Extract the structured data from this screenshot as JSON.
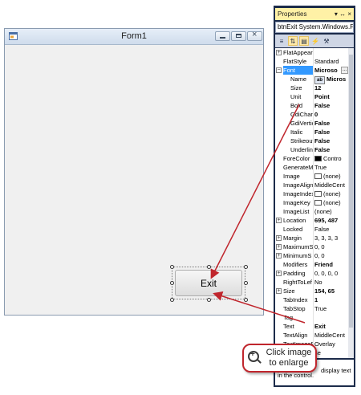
{
  "form": {
    "title": "Form1"
  },
  "exit_button": {
    "label": "Exit"
  },
  "properties_panel": {
    "title": "Properties",
    "title_icons": "▾ ↔ ×",
    "object_selector": "btnExit  System.Windows.F",
    "toolbar": [
      "≡",
      "⇅",
      "▤",
      "⚡",
      "⚒"
    ],
    "rows": [
      {
        "name": "FlatAppear",
        "value": "",
        "expander": "+"
      },
      {
        "name": "FlatStyle",
        "value": "Standard"
      },
      {
        "name": "Font",
        "value": "Microso",
        "expander": "−",
        "bold": true,
        "selected": true,
        "ellipsis": true
      },
      {
        "name": "Name",
        "value": "Micros",
        "sub": true,
        "bold": true,
        "glyph": "ab"
      },
      {
        "name": "Size",
        "value": "12",
        "sub": true,
        "bold": true
      },
      {
        "name": "Unit",
        "value": "Point",
        "sub": true,
        "bold": true
      },
      {
        "name": "Bold",
        "value": "False",
        "sub": true,
        "bold": true
      },
      {
        "name": "GdiChar",
        "value": "0",
        "sub": true,
        "bold": true
      },
      {
        "name": "GdiVertic",
        "value": "False",
        "sub": true,
        "bold": true
      },
      {
        "name": "Italic",
        "value": "False",
        "sub": true,
        "bold": true
      },
      {
        "name": "Strikeout",
        "value": "False",
        "sub": true,
        "bold": true
      },
      {
        "name": "Underlin",
        "value": "False",
        "sub": true,
        "bold": true
      },
      {
        "name": "ForeColor",
        "value": "Contro",
        "swatch": "black"
      },
      {
        "name": "GenerateM",
        "value": "True"
      },
      {
        "name": "Image",
        "value": "(none)",
        "swatch": "white"
      },
      {
        "name": "ImageAlign",
        "value": "MiddleCent"
      },
      {
        "name": "ImageIndex",
        "value": "(none)",
        "swatch": "white"
      },
      {
        "name": "ImageKey",
        "value": "(none)",
        "swatch": "white"
      },
      {
        "name": "ImageList",
        "value": "(none)"
      },
      {
        "name": "Location",
        "value": "695, 487",
        "expander": "+",
        "bold": true
      },
      {
        "name": "Locked",
        "value": "False"
      },
      {
        "name": "Margin",
        "value": "3, 3, 3, 3",
        "expander": "+"
      },
      {
        "name": "MaximumS",
        "value": "0, 0",
        "expander": "+"
      },
      {
        "name": "MinimumS",
        "value": "0, 0",
        "expander": "+"
      },
      {
        "name": "Modifiers",
        "value": "Friend",
        "bold": true
      },
      {
        "name": "Padding",
        "value": "0, 0, 0, 0",
        "expander": "+"
      },
      {
        "name": "RightToLef",
        "value": "No"
      },
      {
        "name": "Size",
        "value": "154, 65",
        "expander": "+",
        "bold": true
      },
      {
        "name": "TabIndex",
        "value": "1",
        "bold": true
      },
      {
        "name": "TabStop",
        "value": "True"
      },
      {
        "name": "Tag",
        "value": ""
      },
      {
        "name": "Text",
        "value": "Exit",
        "bold": true
      },
      {
        "name": "TextAlign",
        "value": "MiddleCent"
      },
      {
        "name": "TextImageR",
        "value": "Overlay"
      },
      {
        "name": "",
        "value": "se"
      }
    ],
    "description_line1": "display text",
    "description_line2": "in the control."
  },
  "enlarge_badge": {
    "line1": "Click image",
    "line2": "to enlarge"
  },
  "colors": {
    "annotation_arrow": "#c0262d",
    "badge_border": "#c0262d",
    "panel_frame": "#1c2b4a",
    "panel_title": "#fff1a6"
  }
}
